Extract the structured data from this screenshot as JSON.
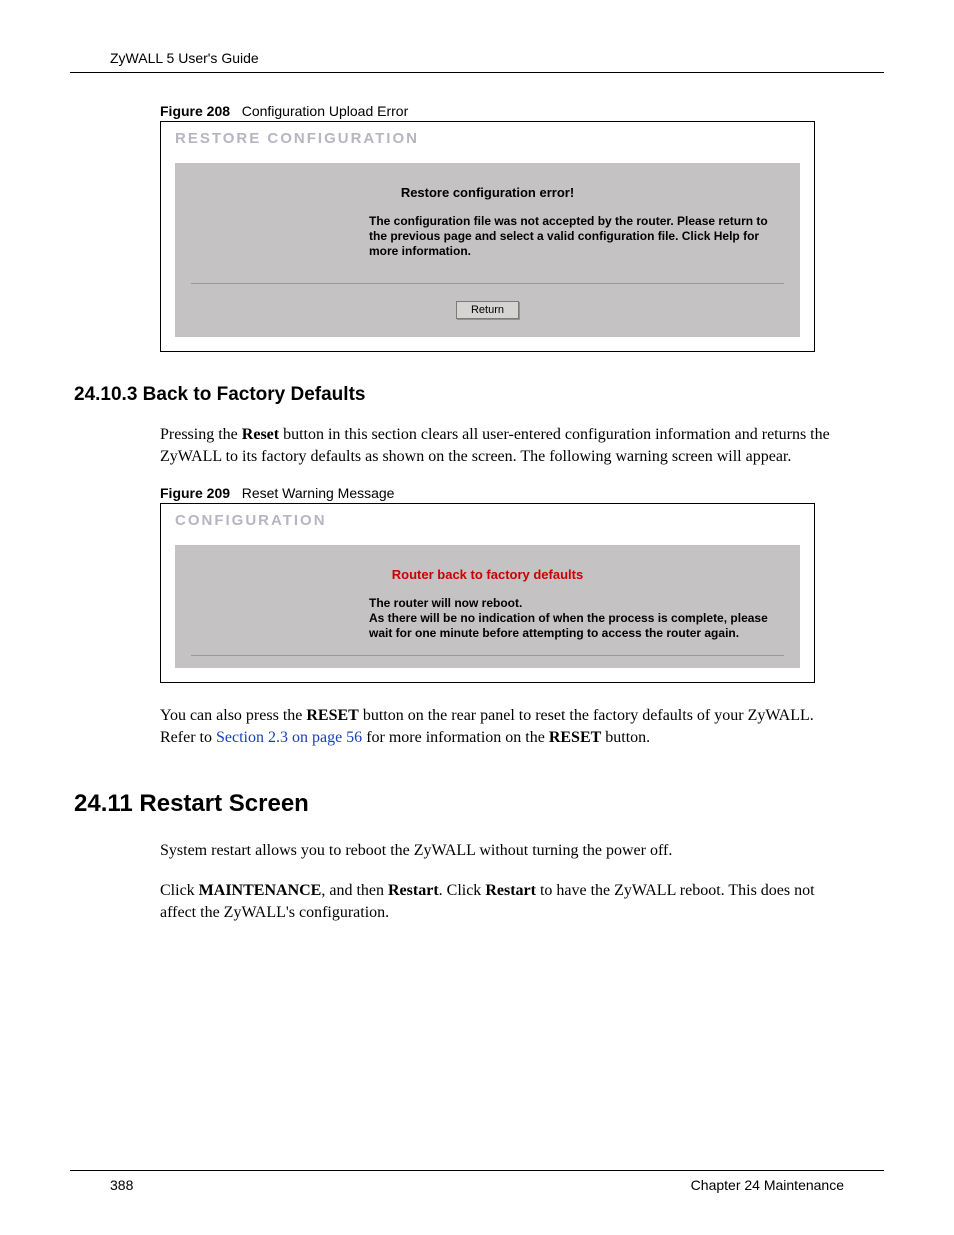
{
  "header": {
    "title": "ZyWALL 5 User's Guide"
  },
  "figure208": {
    "caption_prefix": "Figure 208",
    "caption_text": "Configuration Upload Error",
    "panel_title": "RESTORE CONFIGURATION",
    "heading": "Restore configuration error!",
    "body": "The configuration file was not accepted by the router. Please return to the previous page and select a valid configuration file. Click Help for more information.",
    "button": "Return"
  },
  "section_24_10_3": {
    "heading": "24.10.3  Back to Factory Defaults",
    "para1_a": "Pressing the ",
    "para1_b_bold": "Reset",
    "para1_c": " button in this section clears all user-entered configuration information and returns the ZyWALL to its factory defaults as shown on the screen. The following warning screen will appear."
  },
  "figure209": {
    "caption_prefix": "Figure 209",
    "caption_text": "Reset Warning Message",
    "panel_title": "CONFIGURATION",
    "heading": "Router back to factory defaults",
    "body_a": "The router ",
    "body_b_bold": "will now",
    "body_c": " reboot.",
    "body_line2": "As there will be no indication of when the process is complete, please wait for one minute before attempting to access the router again."
  },
  "after_fig209": {
    "para_a": "You can also press the ",
    "para_b_bold": "RESET",
    "para_c": " button on the rear panel to reset the factory defaults of your ZyWALL. Refer to ",
    "link": "Section 2.3 on page 56",
    "para_d": " for more information on the ",
    "para_e_bold": "RESET",
    "para_f": " button."
  },
  "section_24_11": {
    "heading": "24.11  Restart Screen",
    "para1": "System restart allows you to reboot the ZyWALL without turning the power off.",
    "para2_a": "Click ",
    "para2_b_bold": "MAINTENANCE",
    "para2_c": ", and then ",
    "para2_d_bold": "Restart",
    "para2_e": ". Click ",
    "para2_f_bold": "Restart",
    "para2_g": " to have the ZyWALL reboot. This does not affect the ZyWALL's configuration."
  },
  "footer": {
    "page": "388",
    "chapter": "Chapter 24 Maintenance"
  }
}
